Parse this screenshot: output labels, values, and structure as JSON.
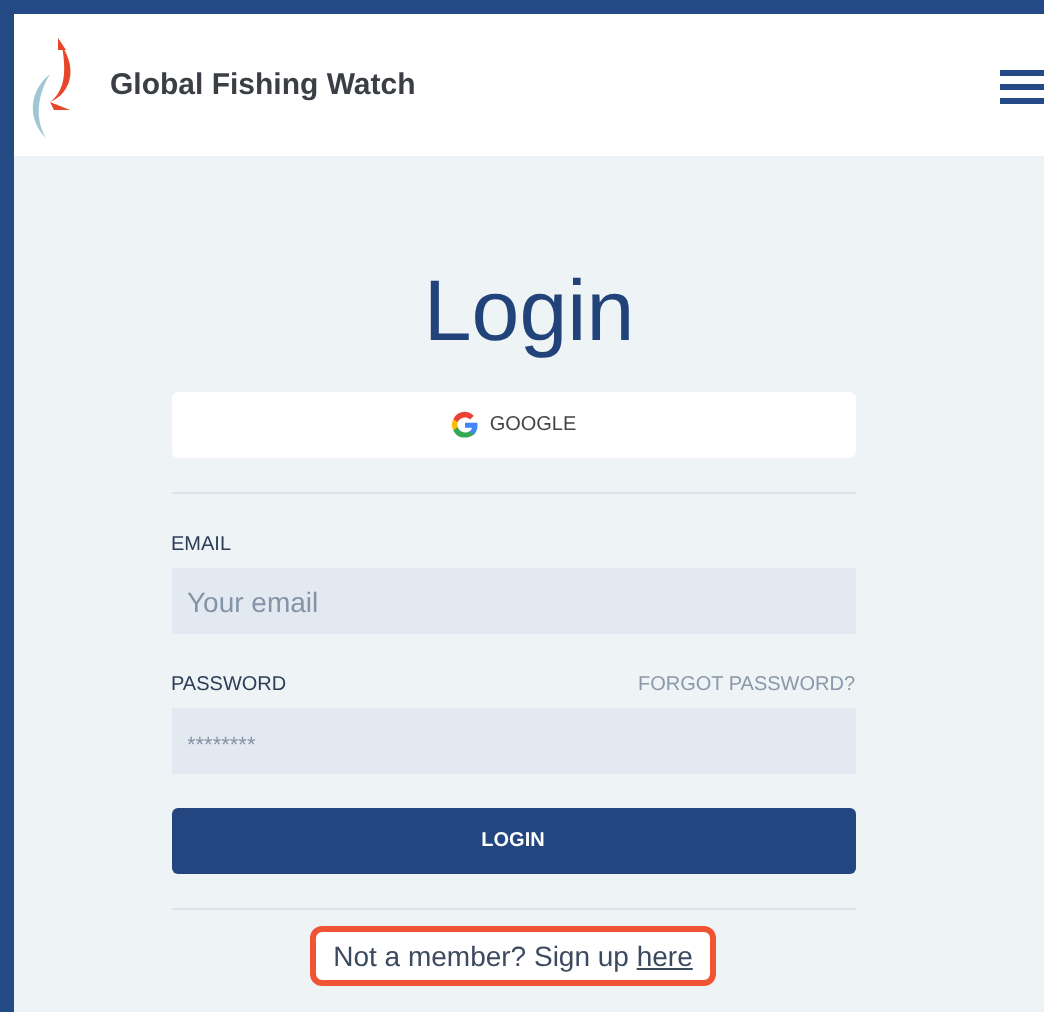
{
  "header": {
    "brand": "Global Fishing Watch"
  },
  "title": "Login",
  "google_button": {
    "label": "GOOGLE"
  },
  "email": {
    "label": "EMAIL",
    "placeholder": "Your email"
  },
  "password": {
    "label": "PASSWORD",
    "forgot_link": "FORGOT PASSWORD?",
    "placeholder": "********"
  },
  "login_button": {
    "label": "LOGIN"
  },
  "signup": {
    "text": "Not a member? Sign up",
    "link": "here",
    "highlighted": true
  }
}
